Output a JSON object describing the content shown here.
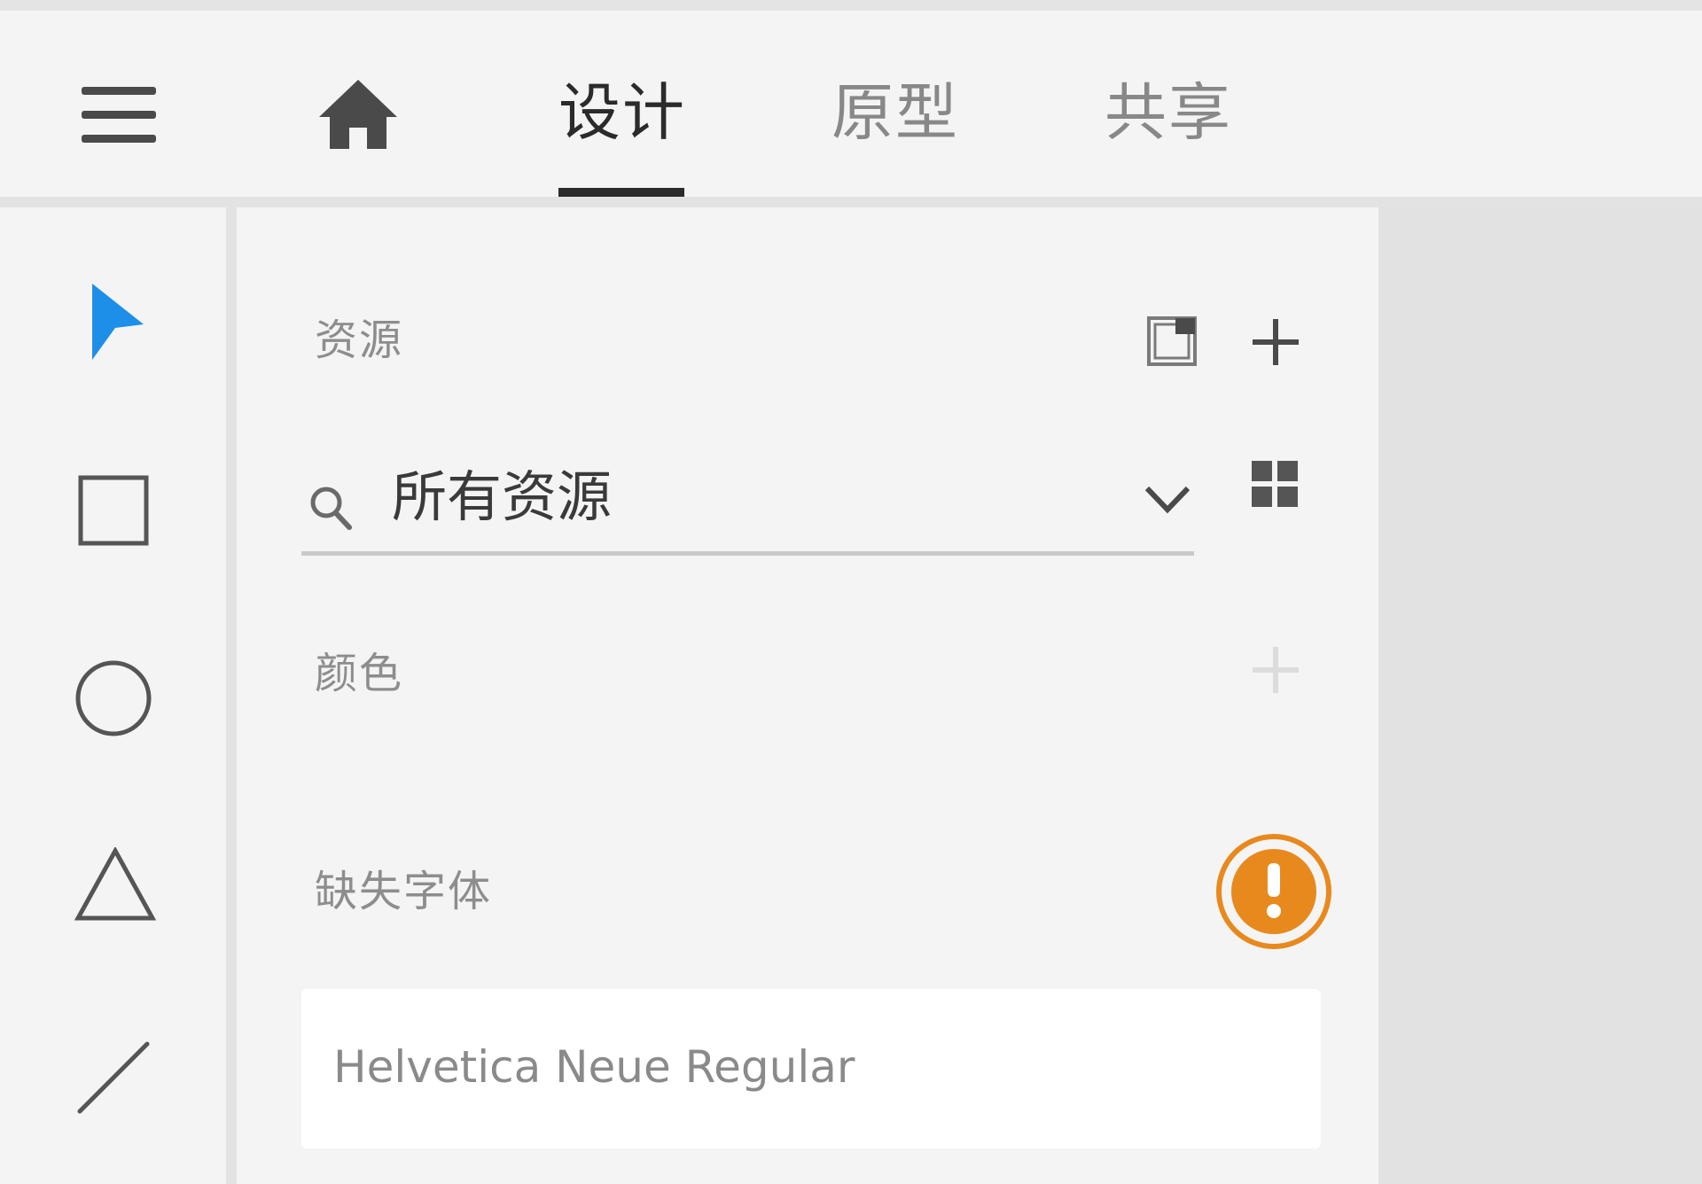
{
  "topbar": {
    "menu_icon": "hamburger-menu-icon",
    "home_icon": "home-icon",
    "tabs": [
      {
        "label": "设计",
        "active": true
      },
      {
        "label": "原型",
        "active": false
      },
      {
        "label": "共享",
        "active": false
      }
    ]
  },
  "toolbar": {
    "tools": [
      {
        "name": "select-arrow-icon",
        "active": true
      },
      {
        "name": "rectangle-icon"
      },
      {
        "name": "ellipse-icon"
      },
      {
        "name": "triangle-icon"
      },
      {
        "name": "line-icon"
      }
    ]
  },
  "assets": {
    "title": "资源",
    "search": {
      "value": "所有资源"
    },
    "colors": {
      "title": "颜色"
    },
    "missing_fonts": {
      "title": "缺失字体",
      "fonts": [
        "Helvetica Neue Regular"
      ]
    }
  },
  "colors": {
    "accent_blue": "#1e8fe8",
    "warning_orange": "#e8891d",
    "text_dark": "#2b2b2b",
    "text_muted": "#8d8d8d"
  }
}
